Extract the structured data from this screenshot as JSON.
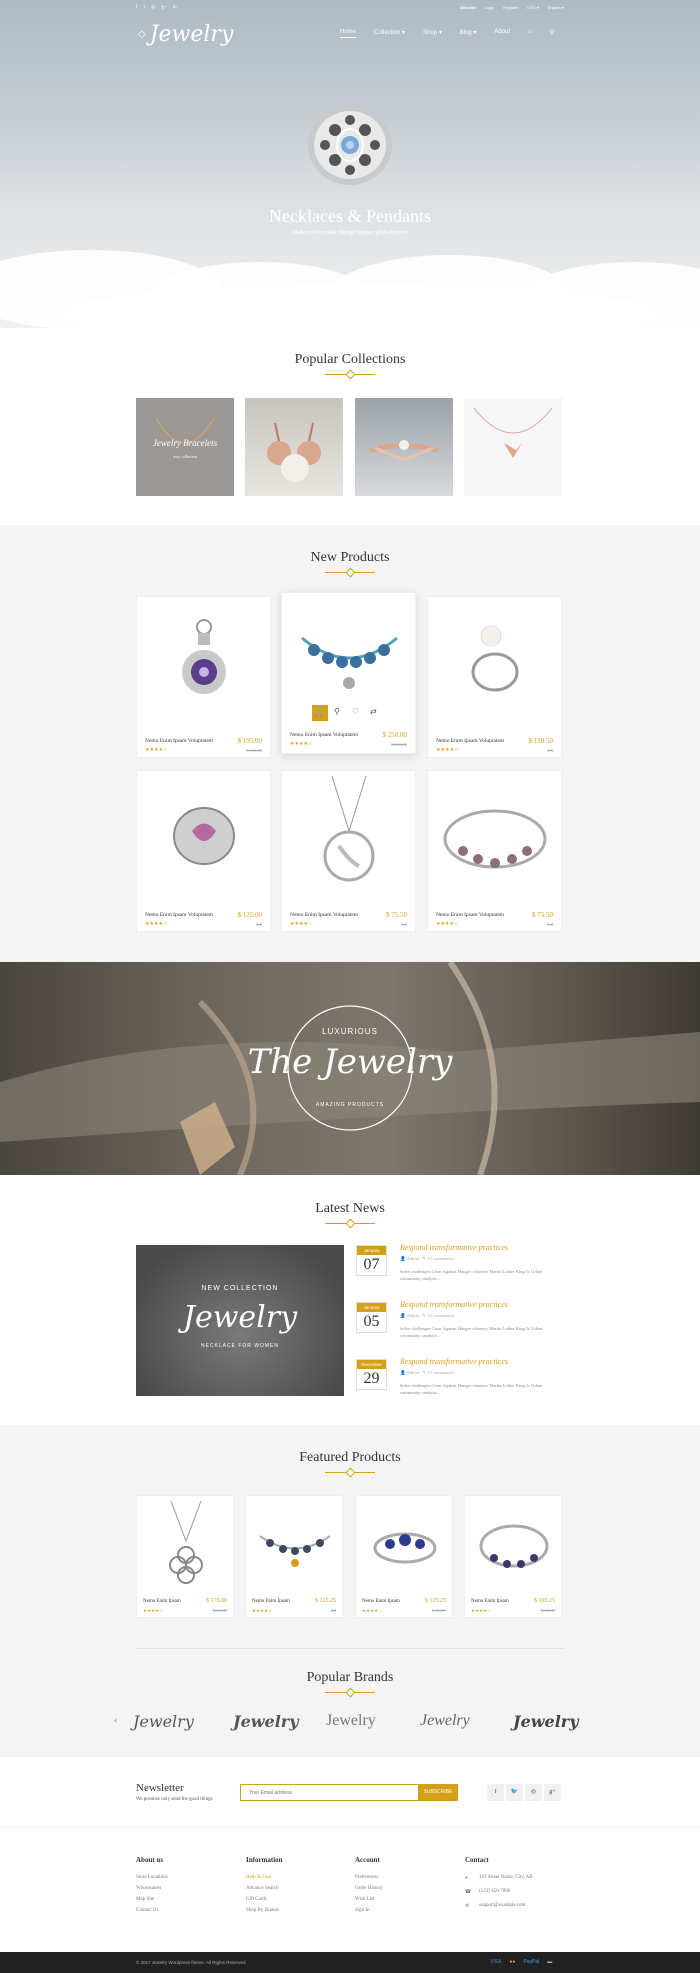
{
  "topbar": {
    "social": [
      "f",
      "t",
      "◎",
      "g+",
      "in"
    ],
    "links": [
      "Wishlist",
      "Login",
      "Register",
      "USD ▾",
      "English ▾"
    ]
  },
  "logo": "Jewelry",
  "nav": [
    "Home",
    "Collection ▾",
    "Shop ▾",
    "Blog ▾",
    "About"
  ],
  "hero": {
    "title": "Necklaces & Pendants",
    "subtitle": "Makers who make change happen globalization"
  },
  "sections": {
    "collections": "Popular Collections",
    "new": "New Products",
    "news": "Latest News",
    "featured": "Featured Products",
    "brands": "Popular Brands"
  },
  "collections": [
    {
      "label": "Jewelry Bracelets",
      "sub": "new collection"
    }
  ],
  "new_products": [
    {
      "name": "Nemo Enim Ipsam Voluptatem",
      "price": "$ 195.00",
      "old": "$ 210.00",
      "stars": "★★★★☆"
    },
    {
      "name": "Nemo Enim Ipsam Voluptatem",
      "price": "$ 250.00",
      "old": "$ 310.00",
      "stars": "★★★★☆"
    },
    {
      "name": "Nemo Enim Ipsam Voluptatem",
      "price": "$ 150.50",
      "old": "$ 0",
      "stars": "★★★★☆"
    },
    {
      "name": "Nemo Enim Ipsam Voluptatem",
      "price": "$ 125.00",
      "old": "$ 0",
      "stars": "★★★★☆"
    },
    {
      "name": "Nemo Enim Ipsam Voluptatem",
      "price": "$ 75.50",
      "old": "$ 0",
      "stars": "★★★★☆"
    },
    {
      "name": "Nemo Enim Ipsam Voluptatem",
      "price": "$ 75.50",
      "old": "$ 0",
      "stars": "★★★★☆"
    }
  ],
  "banner": {
    "top": "LUXURIOUS",
    "main": "The Jewelry",
    "bottom": "AMAZING PRODUCTS"
  },
  "news_image": {
    "top": "NEW COLLECTION",
    "main": "Jewelry",
    "bottom": "NECKLACE FOR WOMEN"
  },
  "news": [
    {
      "month": "January",
      "day": "07",
      "title": "Respond transformative practices",
      "author": "Admin",
      "comments": "12 comment(s)",
      "text": "Solve challenges Cesar Against Hunger citizenry Martin Luther King Jr. Urban community catalytic..."
    },
    {
      "month": "January",
      "day": "05",
      "title": "Respond transformative practices",
      "author": "Admin",
      "comments": "12 comment(s)",
      "text": "Solve challenges Cesar Against Hunger citizenry Martin Luther King Jr. Urban community catalytic..."
    },
    {
      "month": "December",
      "day": "29",
      "title": "Respond transformative practices",
      "author": "Admin",
      "comments": "12 comment(s)",
      "text": "Solve challenges Cesar Against Hunger citizenry Martin Luther King Jr. Urban community catalytic..."
    }
  ],
  "featured": [
    {
      "name": "Nemo Enim Ipsam",
      "price": "$ 175.00",
      "old": "$ 300.00",
      "stars": "★★★★☆"
    },
    {
      "name": "Nemo Enim Ipsam",
      "price": "$ 125.25",
      "old": "$ 0",
      "stars": "★★★★☆"
    },
    {
      "name": "Nemo Enim Ipsam",
      "price": "$ 125.25",
      "old": "$ 150.00",
      "stars": "★★★★☆"
    },
    {
      "name": "Nemo Enim Ipsam",
      "price": "$ 105.25",
      "old": "$ 120.00",
      "stars": "★★★★☆"
    }
  ],
  "brands": [
    "Jewelry",
    "Jewelry",
    "Jewelry",
    "Jewelry",
    "Jewelry"
  ],
  "newsletter": {
    "title": "Newsletter",
    "sub": "We promise only send the good things",
    "placeholder": "Your Email address",
    "button": "SUBSCRIBE"
  },
  "footer": {
    "about": {
      "title": "About us",
      "links": [
        "Store Locations",
        "Whosesalers",
        "Map Site",
        "Contact Us"
      ]
    },
    "info": {
      "title": "Information",
      "links": [
        "Help & Faqs",
        "Advance Search",
        "Gift Cards",
        "Shop By Brands"
      ]
    },
    "account": {
      "title": "Account",
      "links": [
        "Preferences",
        "Order History",
        "Wish List",
        "Sign In"
      ]
    },
    "contact": {
      "title": "Contact",
      "lines": [
        "123 Street Name, City, AB",
        "(123) 456-7890",
        "support@example.com"
      ]
    },
    "copyright": "© 2017 Jewelry Wordpress theme. All Rights Reserved",
    "payments": [
      "VISA",
      "●●",
      "PayPal",
      "▬"
    ]
  },
  "colors": {
    "accent": "#d4a017"
  }
}
